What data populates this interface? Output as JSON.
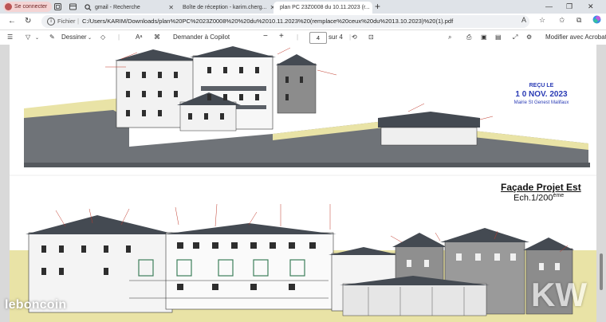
{
  "browser": {
    "sign_in": "Se connecter",
    "tabs": [
      {
        "label": "gmail - Recherche"
      },
      {
        "label": "Boîte de réception - karim.cherg..."
      },
      {
        "label": "plan PC 23Z0008 du 10.11.2023 (r..."
      }
    ],
    "new_tab": "+",
    "address_prefix": "Fichier",
    "address_separator": "|",
    "url": "C:/Users/KARIM/Downloads/plan%20PC%2023Z0008%20%20du%2010.11.2023%20(remplace%20ceux%20du%2013.10.2023)%20(1).pdf"
  },
  "pdf_toolbar": {
    "draw_label": "Dessiner",
    "copilot_label": "Demander à Copilot",
    "page_current": "4",
    "page_total": "sur 4",
    "acrobat_label": "Modifier avec Acrobat"
  },
  "document": {
    "stamp_line1": "REÇU LE",
    "stamp_date": "1 0 NOV. 2023",
    "stamp_line3": "Mairie St Genest Malifaux",
    "facade_title": "Façade Projet Est",
    "scale_label": "Ech.1/200",
    "scale_suffix": "ème"
  },
  "watermark": {
    "brand": "leboncoin",
    "brand_right": "KW"
  },
  "colors": {
    "tab_strip": "#dfe3e8",
    "stamp_blue": "#2a3bb5",
    "ground_yellow": "#e4dc8c",
    "roof_dark": "#444a52"
  },
  "icons": [
    "avatar-icon",
    "workspaces-icon",
    "tab-actions-icon",
    "search-icon",
    "gmail-icon",
    "pdf-icon",
    "back-icon",
    "refresh-icon",
    "info-icon",
    "read-aloud-icon",
    "favorite-icon",
    "favorites-icon",
    "extensions-icon",
    "copilot-icon",
    "contents-icon",
    "filter-icon",
    "draw-icon",
    "eraser-icon",
    "text-icon",
    "copilot-chat-icon",
    "minus-icon",
    "plus-icon",
    "rotate-icon",
    "fit-icon",
    "find-icon",
    "print-icon",
    "save-icon",
    "save-as-icon",
    "fullscreen-icon",
    "settings-icon"
  ]
}
